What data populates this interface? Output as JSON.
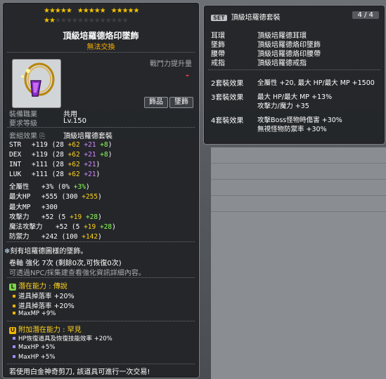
{
  "item": {
    "stars_row1": "★★★★★",
    "stars_row2": "★★★★★",
    "stars_row3": "★★★★★",
    "stars_row4": "★★",
    "stars_empty": "★★★★★★★★★★★★★",
    "name": "頂級培羅德烙印墜飾",
    "untradeable": "無法交換",
    "combat_power_label": "戰鬥力提升量",
    "combat_power_value": "-",
    "category_tag1": "飾品",
    "category_tag2": "墜飾",
    "job_label": "裝備職業",
    "job_value": "共用",
    "level_label": "要求等級",
    "level_value": "Lv.150",
    "set_label": "套組效果",
    "set_name": "頂級培羅德套裝",
    "stats": [
      {
        "name": "STR",
        "total": "+119",
        "base": "(28 ",
        "add1": "+62",
        "add2": " +21",
        "add3": " +8",
        "close": ")"
      },
      {
        "name": "DEX",
        "total": "+119",
        "base": "(28 ",
        "add1": "+62",
        "add2": " +21",
        "add3": " +8",
        "close": ")"
      },
      {
        "name": "INT",
        "total": "+111",
        "base": "(28 ",
        "add1": "+62",
        "add2": " +21",
        "add3": "",
        "close": ")"
      },
      {
        "name": "LUK",
        "total": "+111",
        "base": "(28 ",
        "add1": "+62",
        "add2": " +21",
        "add3": "",
        "close": ")"
      }
    ],
    "allstat": {
      "name": "全屬性",
      "total": "+3%",
      "base": "(0% ",
      "add": "+3%",
      "close": ")"
    },
    "maxhp": {
      "name": "最大HP",
      "total": "+555",
      "base": "(300 ",
      "add": "+255",
      "close": ")"
    },
    "maxmp": {
      "name": "最大MP",
      "total": "+300"
    },
    "atk": {
      "name": "攻擊力",
      "total": "+52",
      "base": "(5 ",
      "add1": "+19",
      "add2": " +28",
      "close": ")"
    },
    "matk": {
      "name": "魔法攻擊力",
      "total": "+52",
      "base": "(5 ",
      "add1": "+19",
      "add2": " +28",
      "close": ")"
    },
    "def": {
      "name": "防禦力",
      "total": "+242",
      "base": "(100 ",
      "add": "+142",
      "close": ")"
    },
    "desc": "刻有培羅德圖樣的墜飾。",
    "scroll": "卷軸 強化 7次 (剩餘0次,可恢復0次)",
    "npc_hint": "可透過NPC/採集建查看強化資訊詳細內容。",
    "potential_badge": "L",
    "potential_label": "潛在能力 : 傳說",
    "potential_lines": [
      "道具掉落率 +20%",
      "道具掉落率 +20%",
      "MaxMP +9%"
    ],
    "bonus_badge": "U",
    "bonus_label": "附加潛在能力 : 罕見",
    "bonus_lines": [
      "HP恢復道具及恢復技能效率 +20%",
      "MaxHP +5%",
      "MaxHP +5%"
    ],
    "footer": "若使用白金神奇剪刀, 該道具可進行一次交易!"
  },
  "set": {
    "tag": "SET",
    "name": "頂級培羅德套裝",
    "count": "4 / 4",
    "parts": [
      {
        "slot": "耳環",
        "item": "頂級培羅德耳環"
      },
      {
        "slot": "墜飾",
        "item": "頂級培羅德烙印墜飾"
      },
      {
        "slot": "腰帶",
        "item": "頂級培羅德烙印腰帶"
      },
      {
        "slot": "戒指",
        "item": "頂級培羅德戒指"
      }
    ],
    "effects": [
      {
        "label": "2套裝效果",
        "lines": [
          "全屬性 +20, 最大 HP/最大 MP +1500"
        ]
      },
      {
        "label": "3套裝效果",
        "lines": [
          "最大 HP/最大 MP +13%",
          "攻擊力/魔力 +35"
        ]
      },
      {
        "label": "4套裝效果",
        "lines": [
          "攻擊Boss怪物時傷害 +30%",
          "無視怪物防禦率 +30%"
        ]
      }
    ]
  },
  "colors": {
    "star": "#f2c200",
    "orange": "#ffb000",
    "green": "#8bff58",
    "purple": "#d18cff",
    "blue": "#8fa7ff"
  }
}
